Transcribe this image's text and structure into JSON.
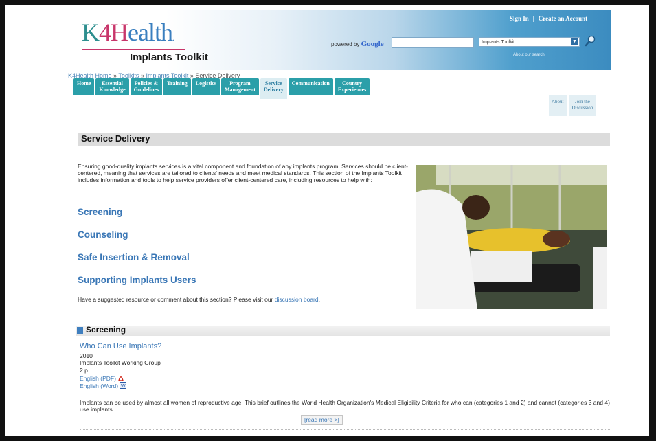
{
  "header": {
    "logo_text": "K4Health",
    "title": "Implants Toolkit",
    "powered_by": "powered by",
    "google": "Google",
    "search_value": "",
    "search_scope": "Implants Toolkit",
    "about_search": "About our search",
    "sign_in": "Sign In",
    "separator": "|",
    "create_account": "Create an Account"
  },
  "breadcrumb": {
    "home": "K4Health Home",
    "sep": "»",
    "toolkits": "Toolkits",
    "implants": "Implants Toolkit",
    "current": "Service Delivery"
  },
  "nav": {
    "tabs": [
      {
        "l1": "Home",
        "l2": ""
      },
      {
        "l1": "Essential",
        "l2": "Knowledge"
      },
      {
        "l1": "Policies &",
        "l2": "Guidelines"
      },
      {
        "l1": "Training",
        "l2": ""
      },
      {
        "l1": "Logistics",
        "l2": ""
      },
      {
        "l1": "Program",
        "l2": "Management"
      },
      {
        "l1": "Service",
        "l2": "Delivery"
      },
      {
        "l1": "Communication",
        "l2": ""
      },
      {
        "l1": "Country",
        "l2": "Experiences"
      }
    ],
    "about": "About",
    "join_l1": "Join the",
    "join_l2": "Discussion"
  },
  "page": {
    "section_title": "Service Delivery",
    "intro": "Ensuring good-quality implants services is a vital component and foundation of any implants program. Services should be client-centered, meaning that services are tailored to clients' needs and meet medical standards. This section of the Implants Toolkit includes information and tools to help service providers offer client-centered care, including resources to help with:",
    "topics": [
      "Screening",
      "Counseling",
      "Safe Insertion & Removal",
      "Supporting Implants Users"
    ],
    "suggest_text": "Have a suggested resource or comment about this section? Please visit our",
    "suggest_link": "discussion board",
    "suggest_end": "."
  },
  "screening": {
    "heading": "Screening",
    "resource_title": "Who Can Use Implants?",
    "year": "2010",
    "author": "Implants Toolkit Working Group",
    "pages": "2 p",
    "pdf": "English (PDF)",
    "word": "English (Word)",
    "description": "Implants can be used by almost all women of reproductive age. This brief outlines the World Health Organization's Medical Eligibility Criteria for who can (categories 1 and 2) and cannot (categories 3 and 4) use implants.",
    "read_more": "[read more >]"
  },
  "colors": {
    "tab": "#2b9fa9",
    "link": "#3a77b6",
    "header_blue": "#3c8cc0"
  }
}
